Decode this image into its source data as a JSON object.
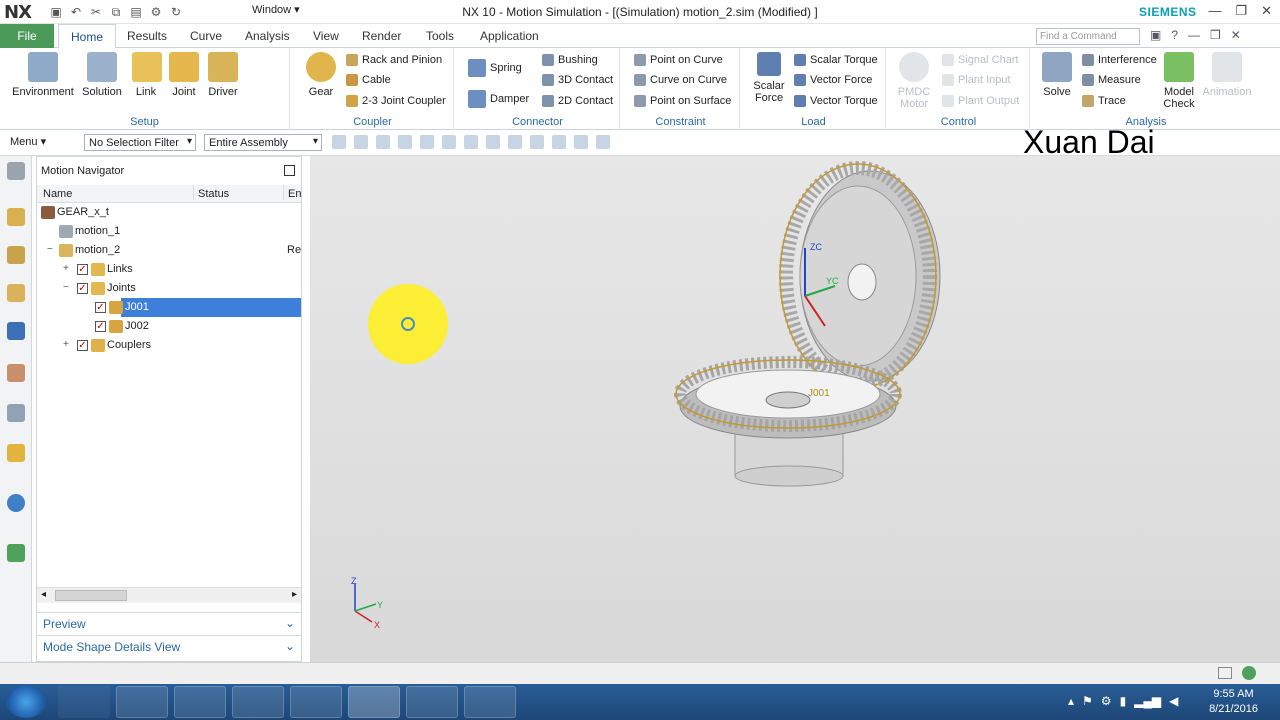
{
  "app": {
    "logo": "NX",
    "window_menu": "Window ▾",
    "title": "NX 10 - Motion Simulation - [(Simulation) motion_2.sim (Modified) ]",
    "brand": "SIEMENS"
  },
  "tabs": [
    "File",
    "Home",
    "Results",
    "Curve",
    "Analysis",
    "View",
    "Render",
    "Tools",
    "Application"
  ],
  "search": {
    "placeholder": "Find a Command"
  },
  "ribbon": {
    "setup": {
      "label": "Setup",
      "buttons": [
        "Environment",
        "Solution",
        "Link",
        "Joint",
        "Driver"
      ]
    },
    "coupler": {
      "label": "Coupler",
      "gear": "Gear",
      "items": [
        "Rack and Pinion",
        "Cable",
        "2-3 Joint Coupler"
      ]
    },
    "connector": {
      "label": "Connector",
      "spring": "Spring",
      "damper": "Damper",
      "items": [
        "Bushing",
        "3D Contact",
        "2D Contact"
      ]
    },
    "constraint": {
      "label": "Constraint",
      "items": [
        "Point on Curve",
        "Curve on Curve",
        "Point on Surface"
      ]
    },
    "load": {
      "label": "Load",
      "scalar_force": "Scalar Force",
      "items": [
        "Scalar Torque",
        "Vector Force",
        "Vector Torque"
      ]
    },
    "control": {
      "label": "Control",
      "pmdc": "PMDC Motor",
      "items": [
        "Signal Chart",
        "Plant Input",
        "Plant Output"
      ]
    },
    "analysis": {
      "label": "Analysis",
      "solve": "Solve",
      "items": [
        "Interference",
        "Measure",
        "Trace"
      ],
      "model_check": "Model Check",
      "animation": "Animation"
    }
  },
  "toolbar": {
    "menu": "Menu ▾",
    "selection_filter": "No Selection Filter",
    "assembly_scope": "Entire Assembly"
  },
  "watermark": "Xuan Dai",
  "navigator": {
    "title": "Motion Navigator",
    "columns": [
      "Name",
      "Status",
      "En"
    ],
    "tree": [
      {
        "label": "GEAR_x_t",
        "status": "",
        "extra": ""
      },
      {
        "label": "motion_1",
        "status": "",
        "extra": ""
      },
      {
        "label": "motion_2",
        "status": "",
        "extra": "Re"
      },
      {
        "label": "Links",
        "status": "",
        "extra": ""
      },
      {
        "label": "Joints",
        "status": "",
        "extra": ""
      },
      {
        "label": "J001",
        "status": "",
        "extra": ""
      },
      {
        "label": "J002",
        "status": "",
        "extra": ""
      },
      {
        "label": "Couplers",
        "status": "",
        "extra": ""
      }
    ],
    "sections": [
      "Preview",
      "Mode Shape Details View"
    ]
  },
  "viewport": {
    "joint_label": "J001",
    "axes": {
      "x": "X",
      "y": "Y",
      "z": "Z",
      "yc": "YC",
      "zc": "ZC"
    }
  },
  "taskbar": {
    "time": "9:55 AM",
    "date": "8/21/2016"
  }
}
